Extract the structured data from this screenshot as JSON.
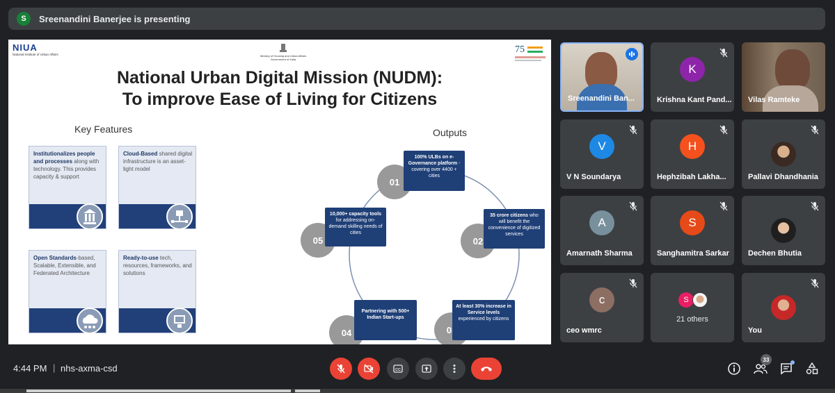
{
  "presenter_bar": {
    "avatar_letter": "S",
    "text": "Sreenandini Banerjee is presenting"
  },
  "slide": {
    "left_logo": "NIUA",
    "left_logo_sub": "National Institute of Urban Affairs",
    "center_logo_line1": "Ministry of Housing and Urban Affairs",
    "center_logo_line2": "Government of India",
    "title_line1": "National Urban Digital Mission (NUDM):",
    "title_line2": "To improve Ease of Living for Citizens",
    "key_features_heading": "Key Features",
    "outputs_heading": "Outputs",
    "features": [
      {
        "bold": "Institutionalizes people and processes",
        "rest": " along with technology. This provides capacity & support",
        "icon": "building-icon"
      },
      {
        "bold": "Cloud-Based",
        "rest": " shared digital infrastructure is an asset-light model",
        "icon": "network-icon"
      },
      {
        "bold": "Open Standards",
        "rest": "-based, Scalable, Extensible, and Federated Architecture",
        "icon": "cloud-icon"
      },
      {
        "bold": "Ready-to-use",
        "rest": " tech, resources, frameworks, and solutions",
        "icon": "tools-icon"
      }
    ],
    "outputs": [
      {
        "num": "01",
        "text_bold": "100% ULBs on e-Governance platform",
        "text": " - covering over 4400 + cities"
      },
      {
        "num": "02",
        "text_bold": "35 crore citizens",
        "text": " who will benefit the convenience of digitized services"
      },
      {
        "num": "03",
        "text_bold": "At least 30% increase in Service levels",
        "text": " experienced by citizens"
      },
      {
        "num": "04",
        "text_bold": "Partnering with 500+ Indian Start-ups",
        "text": ""
      },
      {
        "num": "05",
        "text_bold": "10,000+ capacity tools",
        "text": " for addressing on-demand skilling needs of cities"
      }
    ]
  },
  "participants": [
    {
      "name": "Sreenandini Ban...",
      "type": "photo",
      "speaking": true
    },
    {
      "name": "Krishna Kant Pand...",
      "letter": "K",
      "color": "#8e24aa",
      "muted": true
    },
    {
      "name": "Vilas Ramteke",
      "type": "photo"
    },
    {
      "name": "V N Soundarya",
      "letter": "V",
      "color": "#1e88e5",
      "muted": true
    },
    {
      "name": "Hephzibah Lakha...",
      "letter": "H",
      "color": "#f4511e",
      "muted": true
    },
    {
      "name": "Pallavi Dhandhania",
      "type": "photo",
      "muted": true
    },
    {
      "name": "Amarnath Sharma",
      "letter": "A",
      "color": "#78909c",
      "muted": true
    },
    {
      "name": "Sanghamitra Sarkar",
      "letter": "S",
      "color": "#e64a19",
      "muted": true
    },
    {
      "name": "Dechen Bhutia",
      "type": "photo",
      "muted": true
    },
    {
      "name": "ceo wmrc",
      "letter": "c",
      "color": "#8d6e63",
      "muted": true
    },
    {
      "name": "21 others",
      "type": "others",
      "letter": "S"
    },
    {
      "name": "You",
      "type": "photo",
      "muted": true
    }
  ],
  "bottom_bar": {
    "time": "4:44 PM",
    "separator": "|",
    "meeting_code": "nhs-axma-csd",
    "people_count": "33"
  }
}
